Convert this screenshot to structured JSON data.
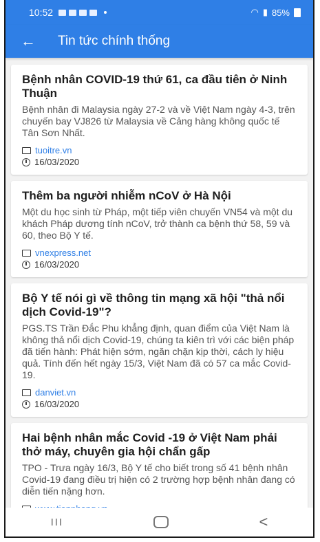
{
  "status_bar": {
    "time": "10:52",
    "battery": "85%"
  },
  "app_bar": {
    "title": "Tin tức chính thống",
    "back_icon": "arrow-left-icon"
  },
  "articles": [
    {
      "title": "Bệnh nhân COVID-19 thứ 61, ca đầu tiên ở Ninh Thuận",
      "summary": "Bệnh nhân đi Malaysia ngày 27-2 và về Việt Nam ngày 4-3, trên chuyến bay VJ826 từ Malaysia về Cảng hàng không quốc tế Tân Sơn Nhất.",
      "source": "tuoitre.vn",
      "date": "16/03/2020"
    },
    {
      "title": "Thêm ba người nhiễm nCoV ở Hà Nội",
      "summary": "Một du học sinh từ Pháp, một tiếp viên chuyến VN54 và một du khách Pháp dương tính nCoV, trở thành ca bệnh thứ 58, 59 và 60, theo Bộ Y tế.",
      "source": "vnexpress.net",
      "date": "16/03/2020"
    },
    {
      "title": "Bộ Y tế nói gì về thông tin mạng xã hội \"thả nổi dịch Covid-19\"?",
      "summary": "PGS.TS Trần Đắc Phu khẳng định, quan điểm của Việt Nam là không thả nổi dịch Covid-19, chúng ta kiên trì với các biện pháp đã tiến hành: Phát hiện sớm, ngăn chặn kịp thời, cách ly hiệu quả. Tính đến hết ngày 15/3, Việt Nam đã có 57 ca mắc Covid-19.",
      "source": "danviet.vn",
      "date": "16/03/2020"
    },
    {
      "title": "Hai bệnh nhân mắc Covid -19 ở Việt Nam phải thở máy, chuyên gia hội chẩn gấp",
      "summary": "TPO - Trưa ngày 16/3, Bộ Y tế cho biết trong số 41 bệnh nhân Covid-19 đang điều trị hiện có 2 trường hợp bệnh nhân đang có diễn tiến nặng hơn.",
      "source": "www.tienphong.vn",
      "date": ""
    }
  ],
  "nav_bar": {
    "recent_label": "III",
    "back_label": "<"
  },
  "colors": {
    "accent": "#2f7fe6",
    "link": "#2f7fe6"
  }
}
